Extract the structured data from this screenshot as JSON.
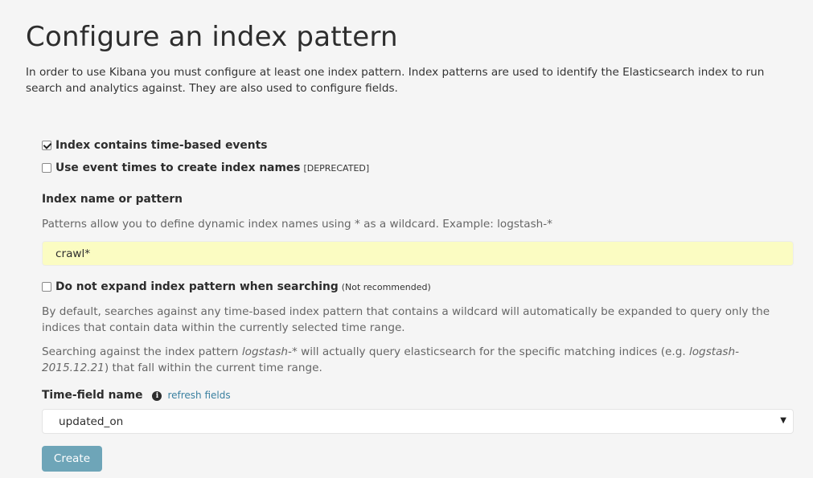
{
  "page": {
    "title": "Configure an index pattern",
    "intro": "In order to use Kibana you must configure at least one index pattern. Index patterns are used to identify the Elasticsearch index to run search and analytics against. They are also used to configure fields."
  },
  "form": {
    "time_based": {
      "label": "Index contains time-based events",
      "checked": true
    },
    "event_times": {
      "label": "Use event times to create index names",
      "note": "[DEPRECATED]",
      "checked": false
    },
    "index_pattern": {
      "label": "Index name or pattern",
      "help": "Patterns allow you to define dynamic index names using * as a wildcard. Example: logstash-*",
      "value": "crawl*"
    },
    "no_expand": {
      "label": "Do not expand index pattern when searching",
      "note": "(Not recommended)",
      "checked": false,
      "help1": "By default, searches against any time-based index pattern that contains a wildcard will automatically be expanded to query only the indices that contain data within the currently selected time range.",
      "help2_a": "Searching against the index pattern ",
      "help2_em1": "logstash-*",
      "help2_b": " will actually query elasticsearch for the specific matching indices (e.g. ",
      "help2_em2": "logstash-2015.12.21",
      "help2_c": ") that fall within the current time range."
    },
    "time_field": {
      "label": "Time-field name",
      "info_icon": "info-circle-icon",
      "refresh_label": "refresh fields",
      "selected": "updated_on"
    },
    "create_label": "Create"
  },
  "colors": {
    "background": "#f5f5f5",
    "input_highlight": "#fbfcc2",
    "link": "#3a80a0",
    "button": "#6ea5b8"
  }
}
